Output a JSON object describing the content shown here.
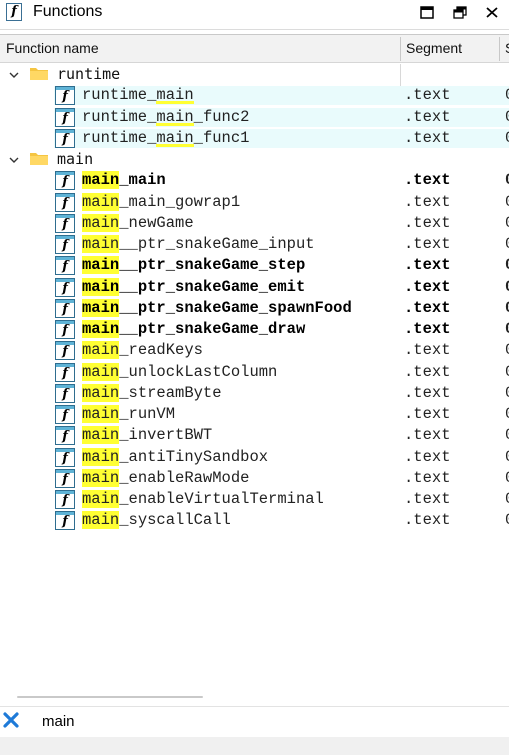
{
  "window": {
    "title": "Functions",
    "icon": "function-icon",
    "buttons": [
      "maximize-icon",
      "restore-icon",
      "close-icon"
    ]
  },
  "columns": {
    "function_name": "Function name",
    "segment": "Segment",
    "more": "S"
  },
  "tree": {
    "groups": [
      {
        "name": "runtime",
        "expanded": true,
        "items": [
          {
            "name": "runtime_main",
            "segment": ".text",
            "start": "0",
            "bold": false,
            "highlighted": true
          },
          {
            "name": "runtime_main_func2",
            "segment": ".text",
            "start": "0",
            "bold": false,
            "highlighted": true
          },
          {
            "name": "runtime_main_func1",
            "segment": ".text",
            "start": "0",
            "bold": false,
            "highlighted": true
          }
        ]
      },
      {
        "name": "main",
        "expanded": true,
        "items": [
          {
            "name": "main_main",
            "segment": ".text",
            "start": "0",
            "bold": true
          },
          {
            "name": "main_main_gowrap1",
            "segment": ".text",
            "start": "0",
            "bold": false
          },
          {
            "name": "main_newGame",
            "segment": ".text",
            "start": "0",
            "bold": false
          },
          {
            "name": "main__ptr_snakeGame_input",
            "segment": ".text",
            "start": "0",
            "bold": false
          },
          {
            "name": "main__ptr_snakeGame_step",
            "segment": ".text",
            "start": "0",
            "bold": true
          },
          {
            "name": "main__ptr_snakeGame_emit",
            "segment": ".text",
            "start": "0",
            "bold": true
          },
          {
            "name": "main__ptr_snakeGame_spawnFood",
            "segment": ".text",
            "start": "0",
            "bold": true
          },
          {
            "name": "main__ptr_snakeGame_draw",
            "segment": ".text",
            "start": "0",
            "bold": true
          },
          {
            "name": "main_readKeys",
            "segment": ".text",
            "start": "0",
            "bold": false
          },
          {
            "name": "main_unlockLastColumn",
            "segment": ".text",
            "start": "0",
            "bold": false
          },
          {
            "name": "main_streamByte",
            "segment": ".text",
            "start": "0",
            "bold": false
          },
          {
            "name": "main_runVM",
            "segment": ".text",
            "start": "0",
            "bold": false
          },
          {
            "name": "main_invertBWT",
            "segment": ".text",
            "start": "0",
            "bold": false
          },
          {
            "name": "main_antiTinySandbox",
            "segment": ".text",
            "start": "0",
            "bold": false
          },
          {
            "name": "main_enableRawMode",
            "segment": ".text",
            "start": "0",
            "bold": false
          },
          {
            "name": "main_enableVirtualTerminal",
            "segment": ".text",
            "start": "0",
            "bold": false
          },
          {
            "name": "main_syscallCall",
            "segment": ".text",
            "start": "0",
            "bold": false
          }
        ]
      }
    ]
  },
  "filter": {
    "value": "main",
    "clear_icon": "clear-filter-icon"
  },
  "colors": {
    "match_highlight": "#ffff33",
    "row_highlight": "#e9fbfc",
    "header_bg": "#f2f2f2",
    "clear_icon": "#1e7ad8"
  }
}
